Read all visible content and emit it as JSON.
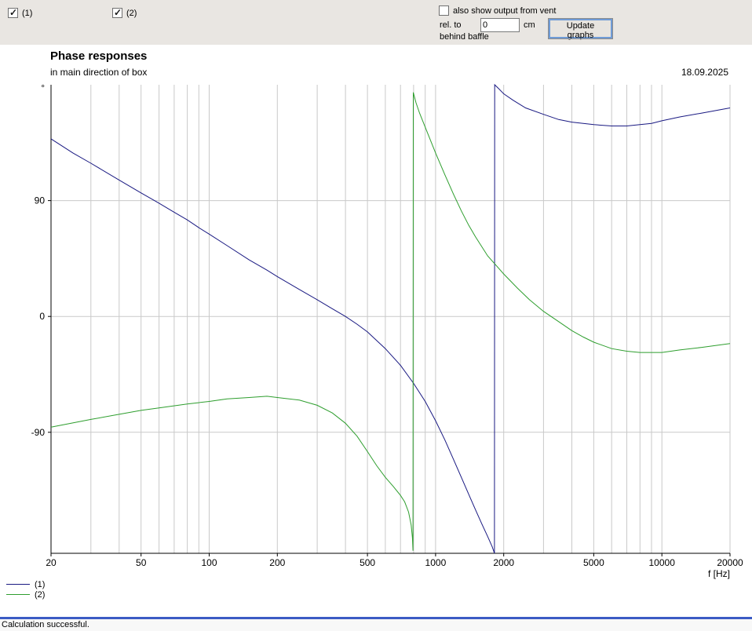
{
  "toolbar": {
    "driver1_checkbox": {
      "label": "(1)",
      "checked": true
    },
    "driver2_checkbox": {
      "label": "(2)",
      "checked": true
    },
    "vent_checkbox": {
      "label": "also show output from vent",
      "checked": false
    },
    "rel_to_label": "rel. to",
    "vent_distance": {
      "value": "0",
      "unit": "cm"
    },
    "behind_baffle_label": "behind baffle",
    "update_button_label": "Update graphs"
  },
  "chart_header": {
    "title": "Phase responses",
    "subtitle": "in main direction of box",
    "date": "18.09.2025"
  },
  "status_bar": {
    "text": "Calculation successful."
  },
  "chart_data": {
    "type": "line",
    "title": "Phase responses",
    "x_scale": "log",
    "xlabel": "f [Hz]",
    "ylabel_unit": "°",
    "xlim": [
      20,
      20000
    ],
    "ylim": [
      -184,
      180
    ],
    "grid": true,
    "x_ticks": [
      {
        "f": 20,
        "label": "20"
      },
      {
        "f": 50,
        "label": "50"
      },
      {
        "f": 100,
        "label": "100"
      },
      {
        "f": 200,
        "label": "200"
      },
      {
        "f": 500,
        "label": "500"
      },
      {
        "f": 1000,
        "label": "1000"
      },
      {
        "f": 2000,
        "label": "2000"
      },
      {
        "f": 5000,
        "label": "5000"
      },
      {
        "f": 10000,
        "label": "10000"
      },
      {
        "f": 20000,
        "label": "20000"
      }
    ],
    "x_gridlines": [
      30,
      40,
      50,
      60,
      70,
      80,
      90,
      100,
      200,
      300,
      400,
      500,
      600,
      700,
      800,
      900,
      1000,
      2000,
      3000,
      4000,
      5000,
      6000,
      7000,
      8000,
      9000,
      10000,
      20000
    ],
    "y_ticks": [
      {
        "value": 90,
        "label": "90"
      },
      {
        "value": 0,
        "label": "0"
      },
      {
        "value": -90,
        "label": "-90"
      }
    ],
    "y_gridlines": [
      90,
      0,
      -90
    ],
    "legend": {
      "position": "bottom-left",
      "entries": [
        {
          "label": "(1)",
          "color": "#191982"
        },
        {
          "label": "(2)",
          "color": "#2e9e2e"
        }
      ]
    },
    "series": [
      {
        "name": "(1)",
        "color": "#191982",
        "points": [
          [
            20,
            138
          ],
          [
            25,
            127
          ],
          [
            30,
            119
          ],
          [
            40,
            106
          ],
          [
            50,
            96
          ],
          [
            60,
            88
          ],
          [
            70,
            81
          ],
          [
            80,
            75
          ],
          [
            90,
            69
          ],
          [
            100,
            64
          ],
          [
            120,
            55
          ],
          [
            150,
            44
          ],
          [
            180,
            36
          ],
          [
            200,
            31
          ],
          [
            250,
            21
          ],
          [
            300,
            13
          ],
          [
            350,
            6
          ],
          [
            400,
            0
          ],
          [
            450,
            -6
          ],
          [
            500,
            -12
          ],
          [
            600,
            -25
          ],
          [
            700,
            -38
          ],
          [
            800,
            -52
          ],
          [
            900,
            -66
          ],
          [
            1000,
            -81
          ],
          [
            1100,
            -96
          ],
          [
            1200,
            -111
          ],
          [
            1300,
            -125
          ],
          [
            1400,
            -138
          ],
          [
            1500,
            -150
          ],
          [
            1600,
            -161
          ],
          [
            1700,
            -171
          ],
          [
            1780,
            -179
          ],
          [
            1820,
            -184
          ],
          [
            1825,
            180
          ],
          [
            1900,
            177
          ],
          [
            2000,
            173
          ],
          [
            2200,
            168
          ],
          [
            2500,
            162
          ],
          [
            3000,
            157
          ],
          [
            3500,
            153
          ],
          [
            4000,
            151
          ],
          [
            5000,
            149
          ],
          [
            6000,
            148
          ],
          [
            7000,
            148
          ],
          [
            8000,
            149
          ],
          [
            9000,
            150
          ],
          [
            10000,
            152
          ],
          [
            12000,
            155
          ],
          [
            15000,
            158
          ],
          [
            20000,
            162
          ]
        ]
      },
      {
        "name": "(2)",
        "color": "#2e9e2e",
        "points": [
          [
            20,
            -86
          ],
          [
            30,
            -80
          ],
          [
            40,
            -76
          ],
          [
            50,
            -73
          ],
          [
            60,
            -71
          ],
          [
            80,
            -68
          ],
          [
            100,
            -66
          ],
          [
            120,
            -64
          ],
          [
            150,
            -63
          ],
          [
            180,
            -62
          ],
          [
            200,
            -63
          ],
          [
            250,
            -65
          ],
          [
            300,
            -69
          ],
          [
            350,
            -75
          ],
          [
            400,
            -83
          ],
          [
            450,
            -93
          ],
          [
            500,
            -105
          ],
          [
            550,
            -116
          ],
          [
            600,
            -125
          ],
          [
            650,
            -132
          ],
          [
            700,
            -139
          ],
          [
            730,
            -144
          ],
          [
            760,
            -152
          ],
          [
            780,
            -162
          ],
          [
            790,
            -172
          ],
          [
            795,
            -182
          ],
          [
            797,
            174
          ],
          [
            820,
            166
          ],
          [
            850,
            158
          ],
          [
            900,
            147
          ],
          [
            1000,
            127
          ],
          [
            1100,
            110
          ],
          [
            1200,
            95
          ],
          [
            1300,
            82
          ],
          [
            1400,
            71
          ],
          [
            1500,
            62
          ],
          [
            1700,
            47
          ],
          [
            2000,
            33
          ],
          [
            2300,
            22
          ],
          [
            2600,
            13
          ],
          [
            3000,
            4
          ],
          [
            3500,
            -4
          ],
          [
            4000,
            -11
          ],
          [
            4500,
            -16
          ],
          [
            5000,
            -20
          ],
          [
            6000,
            -25
          ],
          [
            7000,
            -27
          ],
          [
            8000,
            -28
          ],
          [
            9000,
            -28
          ],
          [
            10000,
            -28
          ],
          [
            12000,
            -26
          ],
          [
            15000,
            -24
          ],
          [
            20000,
            -21
          ]
        ]
      }
    ]
  }
}
